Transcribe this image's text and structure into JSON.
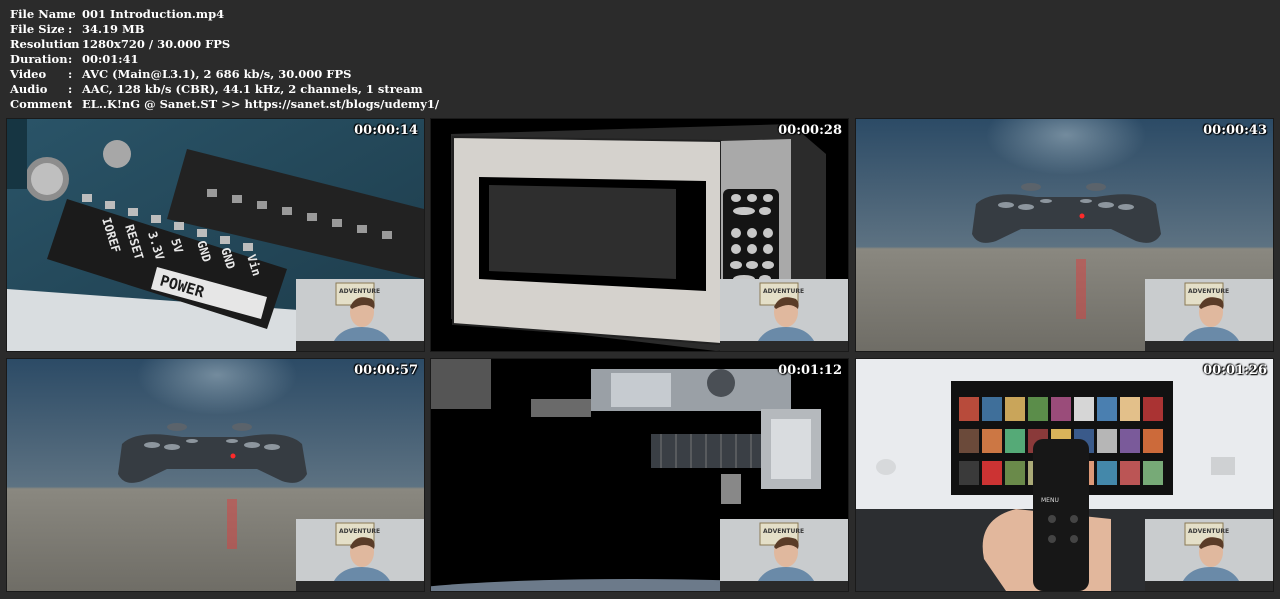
{
  "metadata": [
    {
      "key": "File Name",
      "sep": ":",
      "value": "001 Introduction.mp4"
    },
    {
      "key": "File Size",
      "sep": ":",
      "value": "34.19 MB"
    },
    {
      "key": "Resolution",
      "sep": ":",
      "value": "1280x720 / 30.000 FPS"
    },
    {
      "key": "Duration",
      "sep": ":",
      "value": "00:01:41"
    },
    {
      "key": "Video",
      "sep": ":",
      "value": "AVC (Main@L3.1), 2 686 kb/s, 30.000 FPS"
    },
    {
      "key": "Audio",
      "sep": ":",
      "value": "AAC, 128 kb/s (CBR), 44.1 kHz, 2 channels, 1 stream"
    },
    {
      "key": "Comment",
      "sep": ":",
      "value": "EL..K!nG @ Sanet.ST  >> https://sanet.st/blogs/udemy1/"
    }
  ],
  "thumbnails": [
    {
      "timestamp": "00:00:14",
      "scene": "arduino-board"
    },
    {
      "timestamp": "00:00:28",
      "scene": "microwave"
    },
    {
      "timestamp": "00:00:43",
      "scene": "game-controller"
    },
    {
      "timestamp": "00:00:57",
      "scene": "game-controller"
    },
    {
      "timestamp": "00:01:12",
      "scene": "space-station"
    },
    {
      "timestamp": "00:01:26",
      "scene": "tv-remote"
    }
  ],
  "labels": {
    "arduino_pins": [
      "IOREF",
      "RESET",
      "3.3V",
      "5V",
      "GND",
      "GND",
      "Vin"
    ],
    "arduino_power": "POWER",
    "pip_poster": "ADVENTURE",
    "remote_menu": "MENU"
  },
  "colors": {
    "background": "#2b2b2b",
    "text": "#ffffff"
  }
}
